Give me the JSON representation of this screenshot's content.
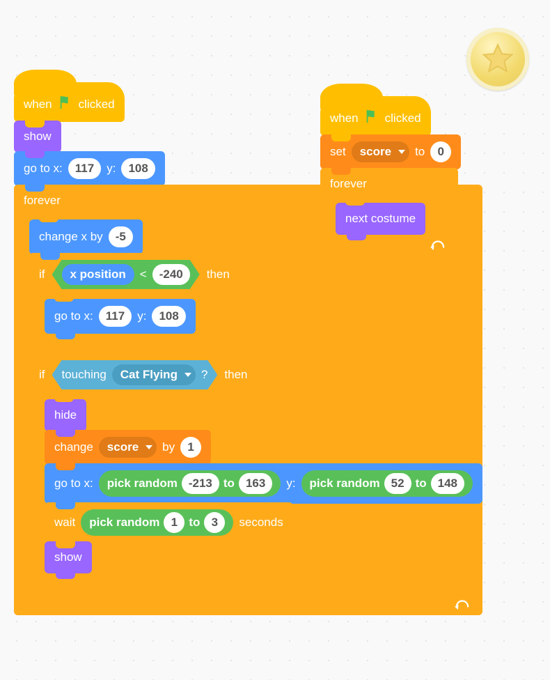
{
  "colors": {
    "events": "#ffbf00",
    "looks": "#9966ff",
    "motion": "#4c97ff",
    "control": "#ffab19",
    "data": "#ff8c1a",
    "operators": "#59c059",
    "sensing": "#5cb1d6"
  },
  "badge": {
    "icon": "star-icon"
  },
  "stack1": {
    "hat": {
      "when": "when",
      "clicked": "clicked",
      "flag": "green-flag-icon"
    },
    "show": "show",
    "goto1": {
      "label_gotox": "go to x:",
      "x": "117",
      "label_y": "y:",
      "y": "108"
    },
    "forever": "forever",
    "changex": {
      "label": "change x by",
      "val": "-5"
    },
    "if1": {
      "if": "if",
      "then": "then",
      "cond": {
        "xpos": "x position",
        "op": "<",
        "rhs": "-240"
      },
      "goto": {
        "label_gotox": "go to x:",
        "x": "117",
        "label_y": "y:",
        "y": "108"
      }
    },
    "if2": {
      "if": "if",
      "then": "then",
      "cond": {
        "touching": "touching",
        "target": "Cat Flying",
        "q": "?"
      },
      "hide": "hide",
      "change_score": {
        "change": "change",
        "var": "score",
        "by": "by",
        "val": "1"
      },
      "goto_rand": {
        "label_gotox": "go to x:",
        "rx": {
          "pick": "pick random",
          "a": "-213",
          "to": "to",
          "b": "163"
        },
        "label_y": "y:",
        "ry": {
          "pick": "pick random",
          "a": "52",
          "to": "to",
          "b": "148"
        }
      },
      "wait": {
        "wait": "wait",
        "r": {
          "pick": "pick random",
          "a": "1",
          "to": "to",
          "b": "3"
        },
        "seconds": "seconds"
      },
      "show": "show"
    }
  },
  "stack2": {
    "hat": {
      "when": "when",
      "clicked": "clicked",
      "flag": "green-flag-icon"
    },
    "set": {
      "set": "set",
      "var": "score",
      "to": "to",
      "val": "0"
    },
    "forever": "forever",
    "next_costume": "next costume"
  }
}
